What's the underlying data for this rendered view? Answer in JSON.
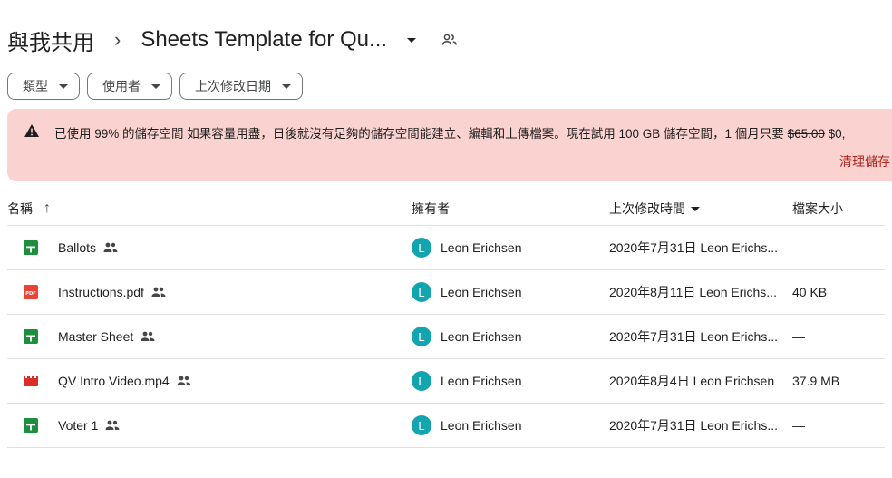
{
  "breadcrumb": {
    "root": "與我共用",
    "separator": "›",
    "current": "Sheets Template for Qu..."
  },
  "filters": [
    {
      "label": "類型"
    },
    {
      "label": "使用者"
    },
    {
      "label": "上次修改日期"
    }
  ],
  "banner": {
    "message": "已使用 99% 的儲存空間 如果容量用盡，日後就沒有足夠的儲存空間能建立、編輯和上傳檔案。現在試用 100 GB 儲存空間，1 個月只要",
    "old_price": "$65.00",
    "new_price": "$0,",
    "link": "清理儲存",
    "color_bg": "#fad2cf",
    "color_link": "#b3261e"
  },
  "table": {
    "headers": {
      "name": "名稱",
      "owner": "擁有者",
      "modified": "上次修改時間",
      "size": "檔案大小"
    },
    "rows": [
      {
        "name": "Ballots",
        "type": "sheet",
        "owner": "Leon Erichsen",
        "avatar": "L",
        "modified": "2020年7月31日 Leon Erichs...",
        "size": "—"
      },
      {
        "name": "Instructions.pdf",
        "type": "pdf",
        "owner": "Leon Erichsen",
        "avatar": "L",
        "modified": "2020年8月11日 Leon Erichs...",
        "size": "40 KB"
      },
      {
        "name": "Master Sheet",
        "type": "sheet",
        "owner": "Leon Erichsen",
        "avatar": "L",
        "modified": "2020年7月31日 Leon Erichs...",
        "size": "—"
      },
      {
        "name": "QV Intro Video.mp4",
        "type": "video",
        "owner": "Leon Erichsen",
        "avatar": "L",
        "modified": "2020年8月4日 Leon Erichsen",
        "size": "37.9 MB"
      },
      {
        "name": "Voter 1",
        "type": "sheet",
        "owner": "Leon Erichsen",
        "avatar": "L",
        "modified": "2020年7月31日 Leon Erichs...",
        "size": "—"
      }
    ]
  },
  "icons": {
    "sheet": "google-sheets-icon",
    "pdf": "pdf-file-icon",
    "video": "video-file-icon",
    "shared": "shared-people-icon",
    "warning": "warning-triangle-icon"
  },
  "colors": {
    "sheet": "#1e8e3e",
    "pdf": "#ea4335",
    "video": "#d93025",
    "avatar": "#12a4af"
  }
}
